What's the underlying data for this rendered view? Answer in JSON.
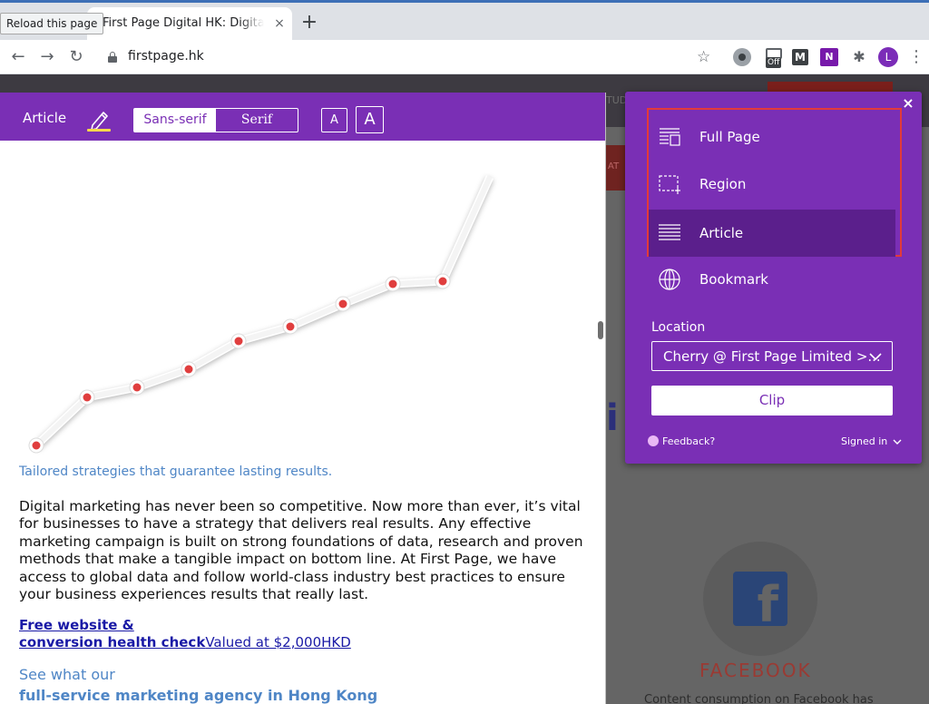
{
  "browser": {
    "tooltip": "Reload this page",
    "tab_title": "First Page Digital HK: Digital Marketing Agency",
    "tab_close": "×",
    "new_tab": "+",
    "url": "firstpage.hk",
    "ext_off_badge": "Off",
    "ext_m_label": "M",
    "ext_onenote_label": "N",
    "avatar_initial": "L"
  },
  "background_page": {
    "fragment_top": "TUD",
    "fragment_side": "AT",
    "heading_fragment": "i",
    "facebook_title": "FACEBOOK",
    "facebook_desc": "Content consumption on Facebook has"
  },
  "reader": {
    "label": "Article",
    "font_options": [
      "Sans-serif",
      "Serif"
    ],
    "size_small": "A",
    "size_big": "A",
    "tagline": "Tailored strategies that guarantee lasting results.",
    "body": "Digital marketing has never been so competitive. Now more than ever, it’s vital for businesses to have a strategy that delivers real results. Any effective marketing campaign is built on strong foundations of data, research and proven methods that make a tangible impact on bottom line. At First Page, we have access to global data and follow world-class industry best practices to ensure your business experiences results that really last.",
    "offer_link_line1": "Free website &",
    "offer_link_line2": "conversion health check",
    "offer_value": "Valued at $2,000HKD",
    "see_text": "See what our",
    "agency_text": "full-service marketing agency in Hong Kong"
  },
  "clipper": {
    "close": "×",
    "modes": [
      {
        "label": "Full Page",
        "icon": "full-page-icon"
      },
      {
        "label": "Region",
        "icon": "region-icon"
      },
      {
        "label": "Article",
        "icon": "article-icon"
      },
      {
        "label": "Bookmark",
        "icon": "globe-icon"
      }
    ],
    "selected_mode": "Article",
    "location_label": "Location",
    "location_value": "Cherry @ First Page Limited >...",
    "clip_button": "Clip",
    "feedback": "Feedback?",
    "signed_in": "Signed in"
  },
  "colors": {
    "onenote_purple": "#7a2fb5",
    "selected_mode": "#5b1f8c",
    "highlight_border": "#e23a3a",
    "chart_point": "#e03e3e"
  }
}
